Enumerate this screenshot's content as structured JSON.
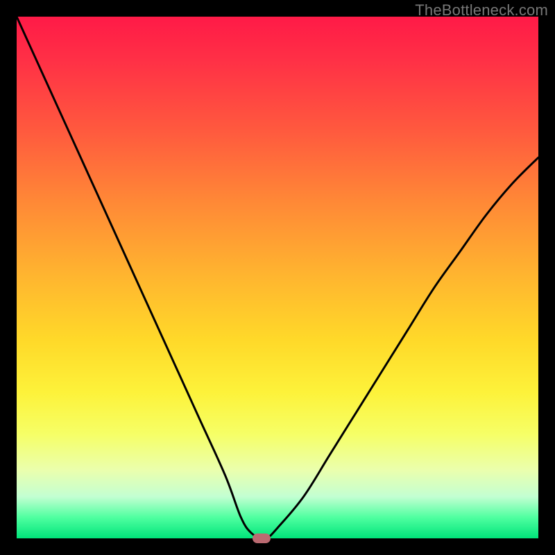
{
  "watermark": "TheBottleneck.com",
  "chart_data": {
    "type": "line",
    "title": "",
    "xlabel": "",
    "ylabel": "",
    "xlim": [
      0,
      100
    ],
    "ylim": [
      0,
      100
    ],
    "x": [
      0,
      5,
      10,
      15,
      20,
      25,
      30,
      35,
      40,
      43,
      45,
      47,
      48,
      50,
      55,
      60,
      65,
      70,
      75,
      80,
      85,
      90,
      95,
      100
    ],
    "values": [
      100,
      89,
      78,
      67,
      56,
      45,
      34,
      23,
      12,
      4,
      1,
      0,
      0,
      2,
      8,
      16,
      24,
      32,
      40,
      48,
      55,
      62,
      68,
      73
    ],
    "marker_x": 47,
    "gradient_stops": [
      {
        "pos": 0,
        "color": "#ff1a47"
      },
      {
        "pos": 50,
        "color": "#ffb62f"
      },
      {
        "pos": 80,
        "color": "#f6ff66"
      },
      {
        "pos": 100,
        "color": "#00e47a"
      }
    ]
  }
}
